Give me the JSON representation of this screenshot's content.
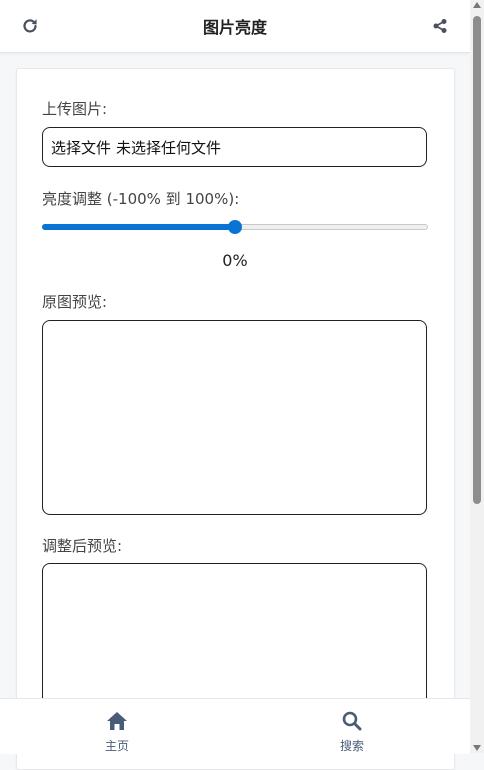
{
  "header": {
    "title": "图片亮度",
    "left_icon": "refresh-icon",
    "right_icon": "share-icon"
  },
  "form": {
    "upload_label": "上传图片:",
    "file_button": "选择文件",
    "file_status": "未选择任何文件",
    "brightness_label": "亮度调整 (-100% 到 100%):",
    "brightness_value": "0%",
    "brightness_fraction": 0.5,
    "original_label": "原图预览:",
    "adjusted_label": "调整后预览:"
  },
  "nav": {
    "home_label": "主页",
    "home_icon": "home-icon",
    "search_label": "搜索",
    "search_icon": "search-icon"
  },
  "colors": {
    "accent": "#0a74d5",
    "nav_text": "#4a5b78"
  }
}
